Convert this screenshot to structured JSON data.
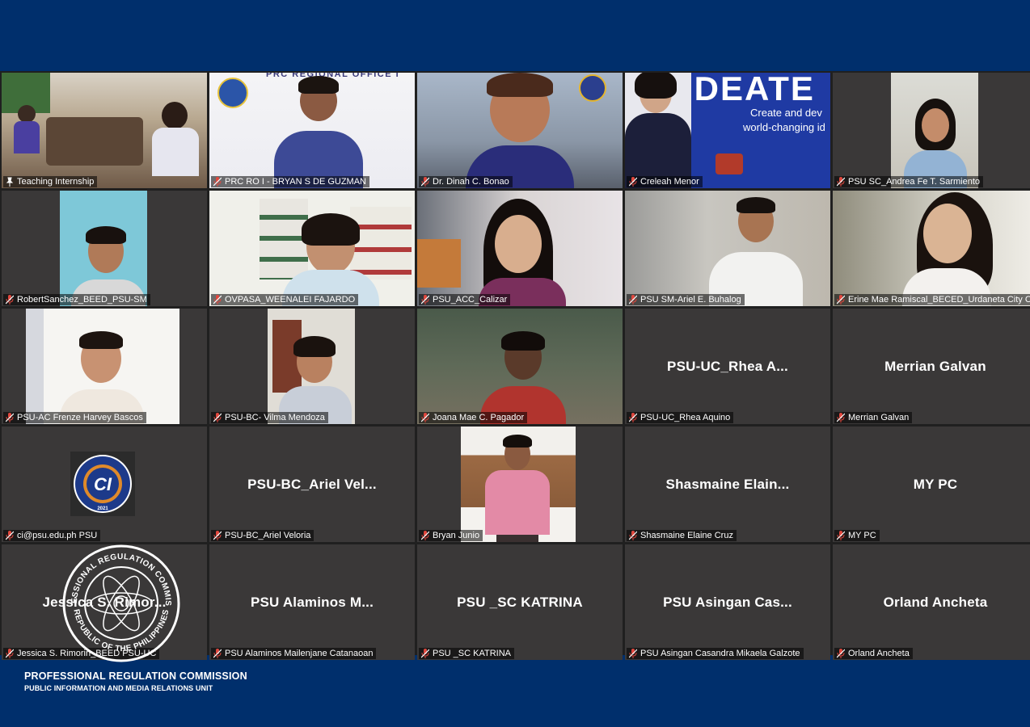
{
  "colors": {
    "frame_background": "#002f6c",
    "grid_background": "#202020",
    "tile_background": "#3a3838",
    "active_border": "#d9e64a",
    "muted_mic": "#e0473d"
  },
  "participants": [
    {
      "label": "Teaching Internship",
      "center_name": "",
      "pinned": true,
      "muted": false,
      "video": true
    },
    {
      "label": "PRC RO I - BRYAN S DE GUZMAN",
      "center_name": "",
      "muted": true,
      "video": true,
      "banner": "PRC REGIONAL OFFICE I"
    },
    {
      "label": "Dr. Dinah C. Bonao",
      "center_name": "",
      "muted": true,
      "video": true
    },
    {
      "label": "Creleah Menor",
      "center_name": "",
      "muted": true,
      "video": true,
      "banner": "IDEATE",
      "banner_sub1": "Create and dev",
      "banner_sub2": "world-changing id"
    },
    {
      "label": "PSU SC_Andrea Fe T. Sarmiento",
      "center_name": "",
      "muted": true,
      "video": true
    },
    {
      "label": "RobertSanchez_BEED_PSU-SM",
      "center_name": "",
      "muted": true,
      "video": true
    },
    {
      "label": "OVPASA_WEENALEI FAJARDO",
      "center_name": "",
      "muted": true,
      "video": true
    },
    {
      "label": "PSU_ACC_Calizar",
      "center_name": "",
      "muted": true,
      "video": true
    },
    {
      "label": "PSU SM-Ariel E. Buhalog",
      "center_name": "",
      "muted": true,
      "video": true
    },
    {
      "label": "Erine Mae Ramiscal_BECED_Urdaneta City Ca...",
      "center_name": "",
      "muted": true,
      "video": true
    },
    {
      "label": "PSU-AC Frenze Harvey Bascos",
      "center_name": "",
      "muted": true,
      "video": true
    },
    {
      "label": "PSU-BC- Vilma Mendoza",
      "center_name": "",
      "muted": true,
      "video": true
    },
    {
      "label": "Joana Mae C. Pagador",
      "center_name": "",
      "muted": true,
      "video": true
    },
    {
      "label": "PSU-UC_Rhea Aquino",
      "center_name": "PSU-UC_Rhea  A...",
      "muted": true,
      "video": false
    },
    {
      "label": "Merrian Galvan",
      "center_name": "Merrian Galvan",
      "muted": true,
      "video": false
    },
    {
      "label": "ci@psu.edu.ph PSU",
      "center_name": "",
      "muted": true,
      "video": false,
      "logo": "ci-logo"
    },
    {
      "label": "PSU-BC_Ariel Veloria",
      "center_name": "PSU-BC_Ariel  Vel...",
      "muted": true,
      "video": false
    },
    {
      "label": "Bryan Junio",
      "center_name": "",
      "muted": true,
      "video": true
    },
    {
      "label": "Shasmaine Elaine Cruz",
      "center_name": "Shasmaine  Elain...",
      "muted": true,
      "video": false
    },
    {
      "label": "MY PC",
      "center_name": "MY PC",
      "muted": true,
      "video": false
    },
    {
      "label": "Jessica  S. Rimorin_BEED PSU-UC",
      "center_name": "Jessica  S.  Rimor...",
      "muted": true,
      "video": false
    },
    {
      "label": "PSU Alaminos Mailenjane Catanaoan",
      "center_name": "PSU  Alaminos  M...",
      "muted": true,
      "video": false
    },
    {
      "label": "PSU _SC KATRINA",
      "center_name": "PSU _SC KATRINA",
      "muted": true,
      "video": false
    },
    {
      "label": "PSU Asingan Casandra Mikaela Galzote",
      "center_name": "PSU  Asingan  Cas...",
      "muted": true,
      "video": false
    },
    {
      "label": "Orland Ancheta",
      "center_name": "Orland Ancheta",
      "muted": true,
      "video": false
    }
  ],
  "footer": {
    "org": "PROFESSIONAL REGULATION COMMISSION",
    "unit": "PUBLIC INFORMATION AND MEDIA RELATIONS UNIT"
  },
  "seal": {
    "text_top": "PROFESSIONAL REGULATION COMMISSION",
    "text_bottom": "REPUBLIC OF THE PHILIPPINES"
  },
  "ci_logo": {
    "letters": "CI",
    "year": "2021"
  }
}
